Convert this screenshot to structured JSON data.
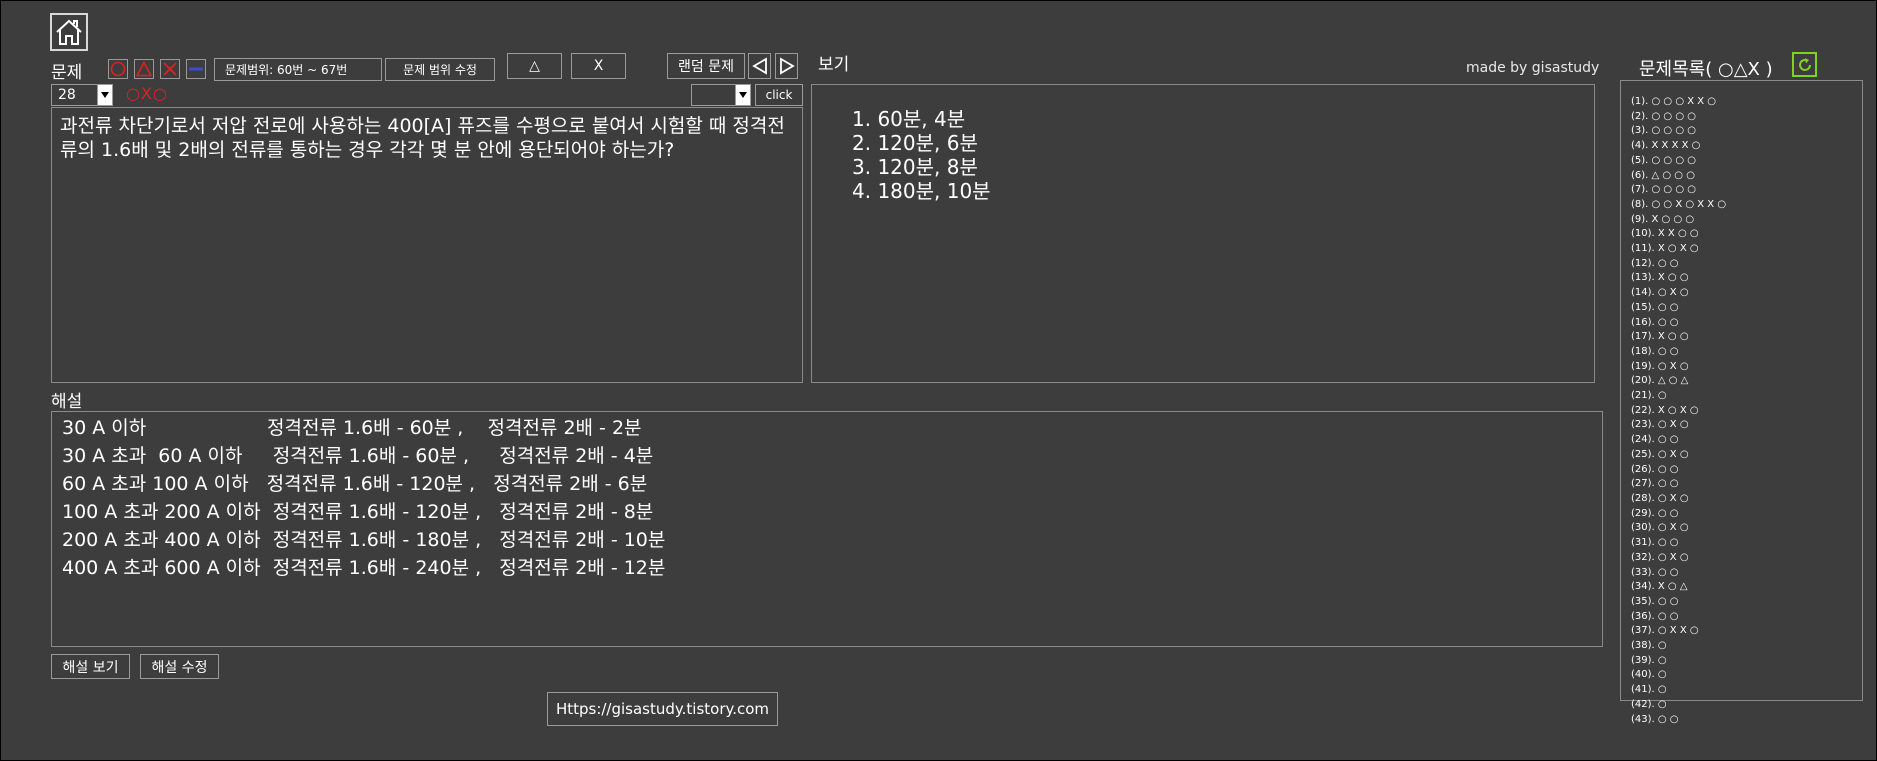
{
  "header": {
    "question_label": "문제",
    "range_text": "문제범위: 60번 ~ 67번",
    "range_edit_label": "문제 범위 수정",
    "triangle_label": "△",
    "x_label": "X",
    "random_label": "랜덤 문제",
    "view_label": "보기",
    "made_by": "made by gisastudy",
    "list_title": "문제목록( ○△X )"
  },
  "question": {
    "number": "28",
    "marks": "○X○",
    "click_label": "click",
    "select_value": "",
    "text": "과전류 차단기로서 저압 전로에 사용하는 400[A] 퓨즈를 수평으로 붙여서 시험할 때 정격전류의 1.6배 및 2배의 전류를 통하는 경우 각각 몇 분 안에 용단되어야 하는가?"
  },
  "choices": [
    "1. 60분, 4분",
    "2. 120분, 6분",
    "3. 120분, 8분",
    "4. 180분, 10분"
  ],
  "explanation": {
    "label": "해설",
    "lines": [
      "30 A 이하                    정격전류 1.6배 - 60분 ,    정격전류 2배 - 2분",
      "30 A 초과  60 A 이하     정격전류 1.6배 - 60분 ,     정격전류 2배 - 4분",
      "60 A 초과 100 A 이하   정격전류 1.6배 - 120분 ,   정격전류 2배 - 6분",
      "100 A 초과 200 A 이하  정격전류 1.6배 - 120분 ,   정격전류 2배 - 8분",
      "200 A 초과 400 A 이하  정격전류 1.6배 - 180분 ,   정격전류 2배 - 10분",
      "400 A 초과 600 A 이하  정격전류 1.6배 - 240분 ,   정격전류 2배 - 12분"
    ],
    "show_label": "해설 보기",
    "edit_label": "해설 수정"
  },
  "footer_url": "Https://gisastudy.tistory.com",
  "problem_list": [
    "(1). ○ ○ ○ X X ○",
    "(2). ○ ○ ○ ○",
    "(3). ○ ○ ○ ○",
    "(4). X X X X ○",
    "(5). ○ ○ ○ ○",
    "(6). △ ○ ○ ○",
    "(7). ○ ○ ○ ○",
    "(8). ○ ○ X ○ X X ○",
    "(9). X ○ ○ ○",
    "(10). X X ○ ○",
    "(11). X ○ X ○",
    "(12). ○ ○",
    "(13). X ○ ○",
    "(14). ○ X ○",
    "(15). ○ ○",
    "(16). ○ ○",
    "(17). X ○ ○",
    "(18). ○ ○",
    "(19). ○ X ○",
    "(20). △ ○ △",
    "(21). ○",
    "(22). X ○ X ○",
    "(23). ○ X ○",
    "(24). ○ ○",
    "(25). ○ X ○",
    "(26). ○ ○",
    "(27). ○ ○",
    "(28). ○ X ○",
    "(29). ○ ○",
    "(30). ○ X ○",
    "(31). ○ ○",
    "(32). ○ X ○",
    "(33). ○ ○",
    "(34). X ○ △",
    "(35). ○ ○",
    "(36). ○ ○",
    "(37). ○ X X ○",
    "(38). ○",
    "(39). ○",
    "(40). ○",
    "(41). ○",
    "(42). ○",
    "(43). ○ ○"
  ],
  "colors": {
    "background": "#3d3d3d",
    "mark_red": "#e02020",
    "mark_blue": "#3a4fd0",
    "refresh_green": "#7ed321"
  }
}
